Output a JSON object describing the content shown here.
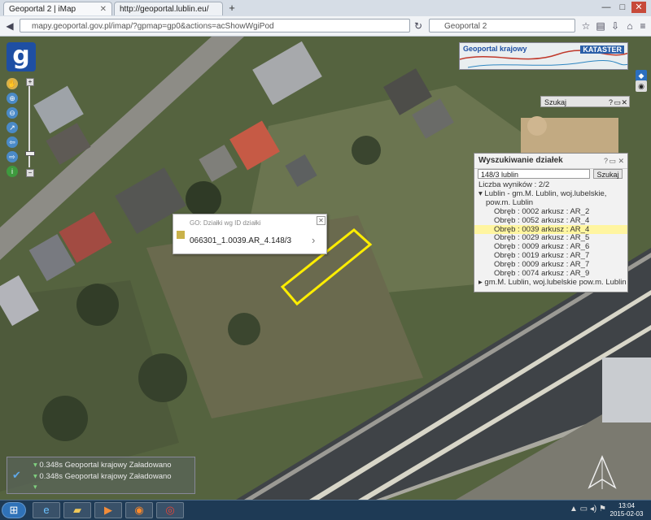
{
  "tabs": [
    {
      "label": "Geoportal 2 | iMap"
    },
    {
      "label": "http://geoportal.lublin.eu/"
    }
  ],
  "window": {
    "minimize": "—",
    "maximize": "□",
    "close": "✕"
  },
  "address": {
    "url": "mapy.geoportal.gov.pl/imap/?gpmap=gp0&actions=acShowWgiPod"
  },
  "search": {
    "placeholder": "Geoportal 2"
  },
  "map": {
    "logo_glyph": "g",
    "banner": {
      "title": "Geoportal krajowy",
      "label": "KATASTER"
    },
    "szukaj": {
      "label": "Szukaj"
    },
    "popup": {
      "header": "GO: Działki wg ID działki",
      "parcel_id": "066301_1.0039.AR_4.148/3"
    },
    "wyszukiwanie": {
      "title": "Wyszukiwanie działek",
      "input_value": "148/3 lublin",
      "button": "Szukaj",
      "count": "Liczba wyników : 2/2",
      "group1": "Lublin - gm.M. Lublin, woj.lubelskie,",
      "group1b": "pow.m. Lublin",
      "results": [
        "Obręb : 0002 arkusz : AR_2",
        "Obręb : 0052 arkusz : AR_4",
        "Obręb : 0039 arkusz : AR_4",
        "Obręb : 0029 arkusz : AR_5",
        "Obręb : 0009 arkusz : AR_6",
        "Obręb : 0019 arkusz : AR_7",
        "Obręb : 0009 arkusz : AR_7",
        "Obręb : 0074 arkusz : AR_9"
      ],
      "highlight_index": 2,
      "group2": "gm.M. Lublin, woj.lubelskie pow.m. Lublin"
    },
    "layers": [
      {
        "opacity": "0.348s",
        "name": "Geoportal krajowy",
        "status": "Załadowano"
      },
      {
        "opacity": "0.348s",
        "name": "Geoportal krajowy",
        "status": "Załadowano"
      }
    ]
  },
  "taskbar": {
    "icons": [
      "start-orb",
      "ie-icon",
      "folder-icon",
      "media-icon",
      "firefox-icon",
      "chrome-icon"
    ],
    "time": "13:04",
    "date": "2015-02-03"
  },
  "colors": {
    "parcel_outline": "#ffee00",
    "logo_bg": "#1e4fa3",
    "highlight": "#fff5a0"
  }
}
